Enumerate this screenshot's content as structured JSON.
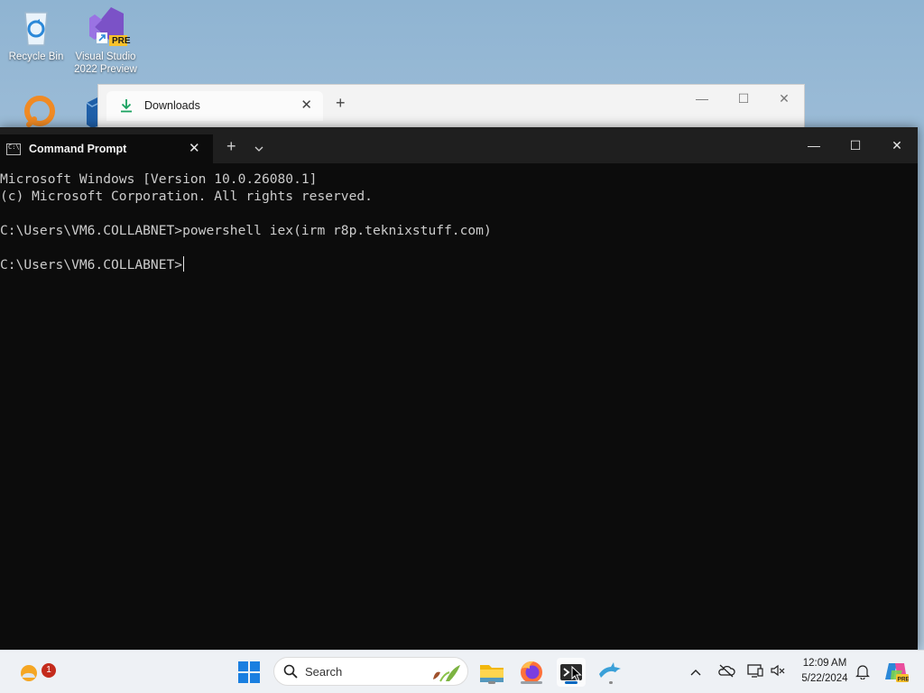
{
  "desktop": {
    "icons": [
      {
        "label": "Recycle Bin"
      },
      {
        "label_line1": "Visual Studio",
        "label_line2": "2022 Preview",
        "badge": "PRE"
      }
    ]
  },
  "explorer": {
    "tab_label": "Downloads",
    "tab_close": "✕",
    "new_tab": "+",
    "minimize": "—",
    "maximize": "☐",
    "close": "✕"
  },
  "terminal": {
    "tab_label": "Command Prompt",
    "tab_close": "✕",
    "new_tab": "+",
    "minimize": "—",
    "maximize": "☐",
    "close": "✕",
    "lines": [
      "Microsoft Windows [Version 10.0.26080.1]",
      "(c) Microsoft Corporation. All rights reserved.",
      "",
      "C:\\Users\\VM6.COLLABNET>powershell iex(irm r8p.teknixstuff.com)",
      "",
      "C:\\Users\\VM6.COLLABNET>"
    ]
  },
  "taskbar": {
    "widgets_badge": "1",
    "search_placeholder": "Search",
    "time": "12:09 AM",
    "date": "5/22/2024"
  },
  "colors": {
    "terminal_bg": "#0c0c0c",
    "terminal_text": "#cccccc",
    "accent": "#0067c0"
  }
}
